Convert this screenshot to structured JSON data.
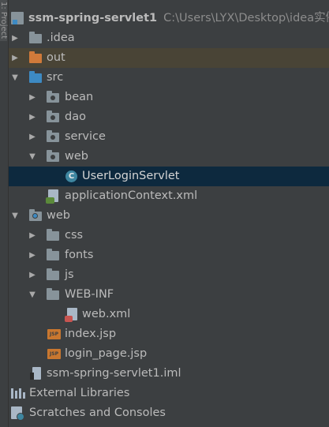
{
  "side_tab": {
    "label": "1: Project"
  },
  "root": {
    "name": "ssm-spring-servlet1",
    "path": "C:\\Users\\LYX\\Desktop\\idea实例"
  },
  "tree": {
    "idea": ".idea",
    "out": "out",
    "src": "src",
    "bean": "bean",
    "dao": "dao",
    "service": "service",
    "web_pkg": "web",
    "servlet": "UserLoginServlet",
    "app_ctx": "applicationContext.xml",
    "web": "web",
    "css": "css",
    "fonts": "fonts",
    "js": "js",
    "webinf": "WEB-INF",
    "webxml": "web.xml",
    "index": "index.jsp",
    "login": "login_page.jsp",
    "iml": "ssm-spring-servlet1.iml",
    "libs": "External Libraries",
    "scratches": "Scratches and Consoles"
  },
  "icons": {
    "collapsed": "chevron-right",
    "expanded": "chevron-down",
    "class_letter": "C",
    "jsp_letters": "JSP"
  },
  "colors": {
    "background": "#3c3f41",
    "selection": "#0d293e",
    "out_highlight": "#494436",
    "folder_blue": "#3d8ac3",
    "folder_orange": "#d07a3a",
    "folder_gray": "#87939a"
  }
}
